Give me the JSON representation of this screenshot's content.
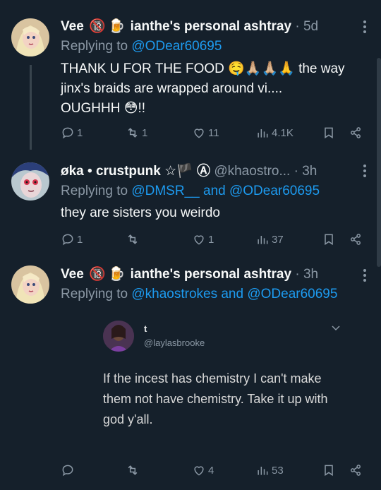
{
  "tweets": [
    {
      "name": "Vee",
      "badges": [
        "🔞",
        "🍺"
      ],
      "display_suffix": "ianthe's personal ashtray",
      "handle": "",
      "time": "5d",
      "reply_prefix": "Replying to",
      "reply_to": "@ODear60695",
      "text_lines": [
        "THANK U FOR THE FOOD 🤤🙏🏼🙏🏼🙏 the way",
        "jinx's braids are wrapped around vi....",
        "OUGHHH 😳!!"
      ],
      "replies": "1",
      "retweets": "1",
      "likes": "11",
      "views": "4.1K"
    },
    {
      "name": "øka • crustpunk ☆🏴 Ⓐ",
      "handle": "@khaostro...",
      "time": "3h",
      "reply_prefix": "Replying to",
      "reply_to_1": "@DMSR__",
      "reply_and": "and",
      "reply_to_2": "@ODear60695",
      "text": "they are sisters you weirdo",
      "replies": "1",
      "retweets": "",
      "likes": "1",
      "views": "37"
    },
    {
      "name": "Vee",
      "badges": [
        "🔞",
        "🍺"
      ],
      "display_suffix": "ianthe's personal ashtray",
      "time": "3h",
      "reply_prefix": "Replying to",
      "reply_to_1": "@khaostrokes",
      "reply_and": "and",
      "reply_to_2": "@ODear60695",
      "quote": {
        "name": "t",
        "handle": "@laylasbrooke",
        "text": "If the incest has chemistry I can't make them not have chemistry. Take it up with god y'all."
      },
      "replies": "",
      "retweets": "",
      "likes": "4",
      "views": "53"
    }
  ],
  "more_icon": "⋮",
  "dot": "·",
  "colors": {
    "background": "#15202b",
    "text": "#f7f9f9",
    "muted": "#8b98a5",
    "link": "#1d9bf0"
  },
  "icons": [
    "reply-icon",
    "retweet-icon",
    "like-icon",
    "views-icon",
    "bookmark-icon",
    "share-icon",
    "more-icon",
    "chevron-down-icon"
  ]
}
